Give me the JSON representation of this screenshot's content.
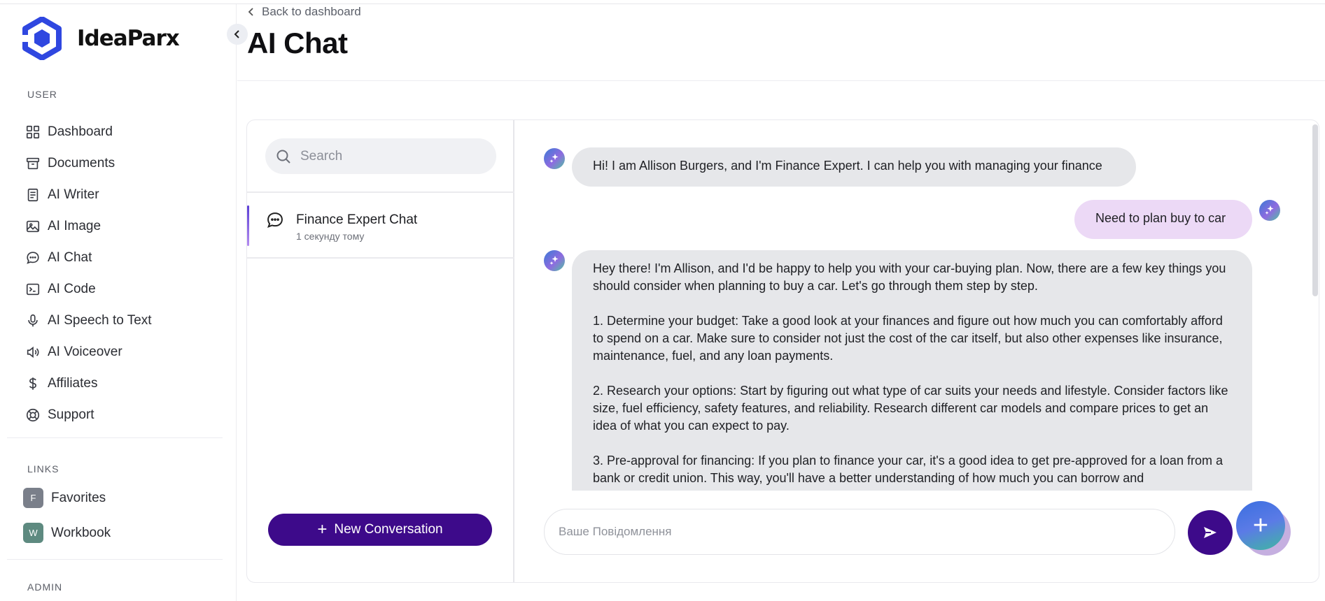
{
  "app": {
    "name": "IdeaParx"
  },
  "sidebar": {
    "user_label": "USER",
    "items": [
      {
        "label": "Dashboard",
        "icon": "grid-icon"
      },
      {
        "label": "Documents",
        "icon": "archive-icon"
      },
      {
        "label": "AI Writer",
        "icon": "document-icon"
      },
      {
        "label": "AI Image",
        "icon": "image-icon"
      },
      {
        "label": "AI Chat",
        "icon": "chat-bubble-icon"
      },
      {
        "label": "AI Code",
        "icon": "terminal-icon"
      },
      {
        "label": "AI Speech to Text",
        "icon": "microphone-icon"
      },
      {
        "label": "AI Voiceover",
        "icon": "speaker-icon"
      },
      {
        "label": "Affiliates",
        "icon": "dollar-icon"
      },
      {
        "label": "Support",
        "icon": "lifebuoy-icon"
      }
    ],
    "links_label": "LINKS",
    "links": [
      {
        "badge": "F",
        "label": "Favorites",
        "color": "#7a7f8a"
      },
      {
        "badge": "W",
        "label": "Workbook",
        "color": "#5e8a80"
      }
    ],
    "admin_label": "ADMIN"
  },
  "header": {
    "back_label": "Back to dashboard",
    "title": "AI Chat"
  },
  "conversations": {
    "search_placeholder": "Search",
    "items": [
      {
        "title": "Finance Expert Chat",
        "time": "1 секунду тому"
      }
    ],
    "new_label": "New Conversation"
  },
  "chat": {
    "messages": [
      {
        "role": "bot",
        "text": "Hi! I am Allison Burgers, and I'm Finance Expert. I can help you with managing your finance"
      },
      {
        "role": "user",
        "text": "Need to plan buy to car"
      },
      {
        "role": "bot",
        "text": "Hey there! I'm Allison, and I'd be happy to help you with your car-buying plan. Now, there are a few key things you should consider when planning to buy a car. Let's go through them step by step.\n\n1. Determine your budget: Take a good look at your finances and figure out how much you can comfortably afford to spend on a car. Make sure to consider not just the cost of the car itself, but also other expenses like insurance, maintenance, fuel, and any loan payments.\n\n2. Research your options: Start by figuring out what type of car suits your needs and lifestyle. Consider factors like size, fuel efficiency, safety features, and reliability. Research different car models and compare prices to get an idea of what you can expect to pay.\n\n3. Pre-approval for financing: If you plan to finance your car, it's a good idea to get pre-approved for a loan from a bank or credit union. This way, you'll have a better understanding of how much you can borrow and"
      }
    ],
    "input_placeholder": "Ваше Повідомлення"
  },
  "colors": {
    "brand": "#3d0a8a",
    "logo": "#2f47e0",
    "user_bubble": "#ecd9f6",
    "bot_bubble": "#e6e7ea"
  }
}
